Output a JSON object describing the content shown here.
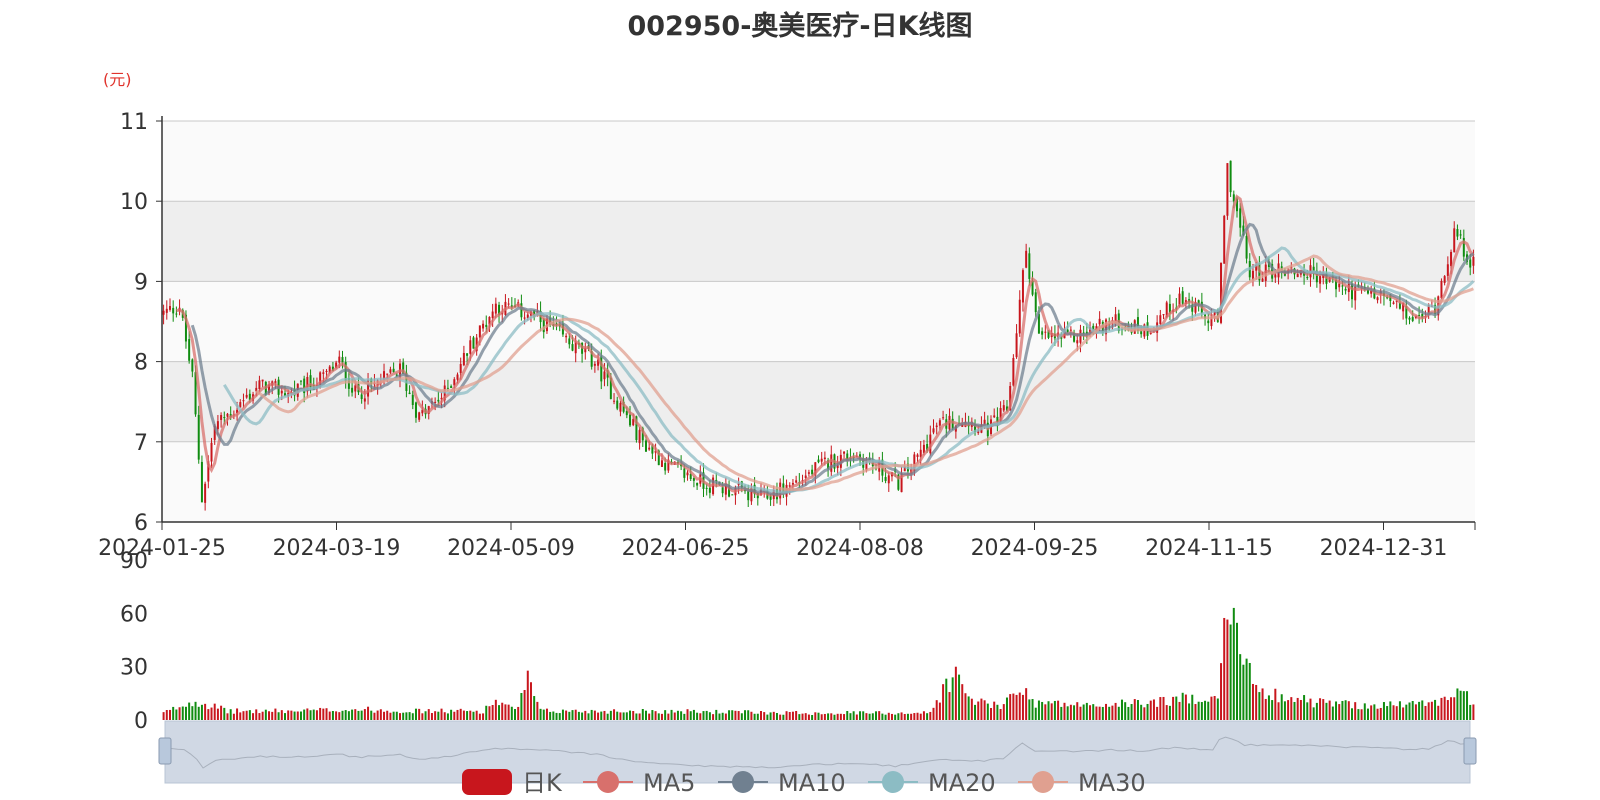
{
  "chart": {
    "title": "002950-奥美医疗-日K线图",
    "y_unit": "(元)",
    "x_ticks": [
      "2024-01-25",
      "2024-03-19",
      "2024-05-09",
      "2024-06-25",
      "2024-08-08",
      "2024-09-25",
      "2024-11-15",
      "2024-12-31"
    ],
    "price_ticks": [
      6,
      7,
      8,
      9,
      10,
      11
    ],
    "volume_ticks": [
      0,
      30,
      60,
      90
    ],
    "legend": [
      "日K",
      "MA5",
      "MA10",
      "MA20",
      "MA30"
    ],
    "colors": {
      "up": "#c8161d",
      "down": "#108c10",
      "ma5": "#d8706c",
      "ma10": "#708090",
      "ma20": "#8cbcc4",
      "ma30": "#e0a090",
      "band_light": "#fafafa",
      "band_dark": "#eeeeee",
      "unit": "#e0332c",
      "slider_fill": "#d0d8e4"
    }
  },
  "chart_data": {
    "type": "candlestick",
    "y_range": [
      6,
      11
    ],
    "volume_range": [
      0,
      90
    ],
    "price_anchors": [
      [
        0,
        8.6
      ],
      [
        5,
        8.7
      ],
      [
        9,
        7.8
      ],
      [
        12,
        6.3
      ],
      [
        16,
        7.2
      ],
      [
        22,
        7.4
      ],
      [
        30,
        7.7
      ],
      [
        40,
        7.6
      ],
      [
        50,
        7.8
      ],
      [
        55,
        8.0
      ],
      [
        60,
        7.6
      ],
      [
        66,
        7.7
      ],
      [
        74,
        7.9
      ],
      [
        80,
        7.3
      ],
      [
        88,
        7.6
      ],
      [
        96,
        8.2
      ],
      [
        104,
        8.7
      ],
      [
        114,
        8.6
      ],
      [
        122,
        8.4
      ],
      [
        128,
        8.2
      ],
      [
        135,
        8.0
      ],
      [
        142,
        7.5
      ],
      [
        150,
        7.0
      ],
      [
        158,
        6.7
      ],
      [
        168,
        6.5
      ],
      [
        178,
        6.4
      ],
      [
        188,
        6.3
      ],
      [
        198,
        6.5
      ],
      [
        208,
        6.75
      ],
      [
        216,
        6.85
      ],
      [
        224,
        6.65
      ],
      [
        230,
        6.5
      ],
      [
        236,
        6.8
      ],
      [
        242,
        7.2
      ],
      [
        250,
        7.3
      ],
      [
        258,
        7.15
      ],
      [
        264,
        7.4
      ],
      [
        270,
        9.4
      ],
      [
        274,
        8.3
      ],
      [
        285,
        8.3
      ],
      [
        296,
        8.5
      ],
      [
        308,
        8.4
      ],
      [
        318,
        8.8
      ],
      [
        326,
        8.55
      ],
      [
        330,
        8.5
      ],
      [
        333,
        10.4
      ],
      [
        340,
        9.1
      ],
      [
        350,
        9.15
      ],
      [
        360,
        9.1
      ],
      [
        370,
        8.9
      ],
      [
        382,
        8.8
      ],
      [
        392,
        8.5
      ],
      [
        398,
        8.7
      ],
      [
        404,
        9.6
      ],
      [
        410,
        9.2
      ]
    ],
    "volume_anchors": [
      [
        0,
        4
      ],
      [
        10,
        11
      ],
      [
        20,
        5
      ],
      [
        40,
        5
      ],
      [
        60,
        6
      ],
      [
        80,
        5
      ],
      [
        100,
        5
      ],
      [
        104,
        11
      ],
      [
        110,
        5
      ],
      [
        114,
        22
      ],
      [
        118,
        5
      ],
      [
        150,
        5
      ],
      [
        200,
        4
      ],
      [
        240,
        4
      ],
      [
        245,
        20
      ],
      [
        248,
        25
      ],
      [
        252,
        12
      ],
      [
        262,
        7
      ],
      [
        268,
        20
      ],
      [
        272,
        10
      ],
      [
        290,
        8
      ],
      [
        310,
        10
      ],
      [
        330,
        14
      ],
      [
        333,
        62
      ],
      [
        336,
        48
      ],
      [
        340,
        25
      ],
      [
        346,
        15
      ],
      [
        360,
        10
      ],
      [
        380,
        8
      ],
      [
        400,
        10
      ],
      [
        403,
        17
      ],
      [
        410,
        11
      ]
    ],
    "series": [
      {
        "name": "日K"
      },
      {
        "name": "MA5",
        "window": 5
      },
      {
        "name": "MA10",
        "window": 10
      },
      {
        "name": "MA20",
        "window": 20
      },
      {
        "name": "MA30",
        "window": 30
      }
    ]
  }
}
